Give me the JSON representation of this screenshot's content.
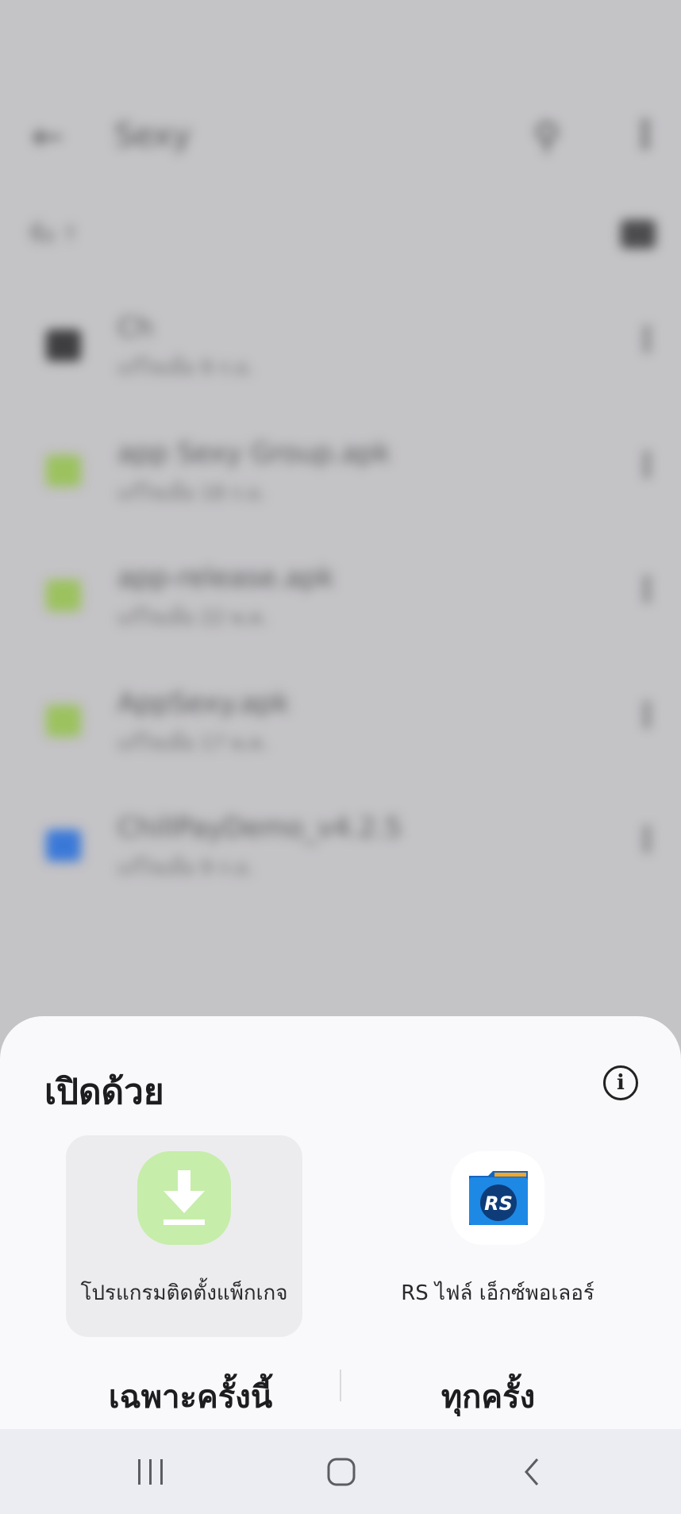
{
  "background": {
    "title": "Sexy",
    "sort_label": "ชื่อ",
    "files": [
      {
        "name": "Ch",
        "meta": "แก้ไขเมื่อ 9 ก.ย.",
        "type": "folder",
        "color": "#3e3e40"
      },
      {
        "name": "app Sexy Group.apk",
        "meta": "แก้ไขเมื่อ 18 ก.ย.",
        "type": "apk",
        "color": "#9bc25e"
      },
      {
        "name": "app-release.apk",
        "meta": "แก้ไขเมื่อ 22 พ.ค.",
        "type": "apk",
        "color": "#9bc25e"
      },
      {
        "name": "AppSexy.apk",
        "meta": "แก้ไขเมื่อ 17 พ.ค.",
        "type": "apk",
        "color": "#9bc25e"
      },
      {
        "name": "ChillPayDemo_v4.2.5",
        "meta": "แก้ไขเมื่อ 9 ก.ย.",
        "type": "doc",
        "color": "#3a78d8"
      }
    ]
  },
  "sheet": {
    "title": "เปิดด้วย",
    "apps": [
      {
        "label": "โปรแกรมติดตั้งแพ็กเกจ",
        "icon": "package-installer-icon",
        "selected": true
      },
      {
        "label": "RS ไฟล์ เอ็กซ์พอเลอร์",
        "icon": "rs-file-explorer-icon",
        "selected": false
      }
    ],
    "just_once": "เฉพาะครั้งนี้",
    "always": "ทุกครั้ง"
  },
  "colors": {
    "sheet_bg": "#f9f9fb",
    "installer_green": "#c6edaa",
    "rs_blue": "#1e88e5"
  }
}
